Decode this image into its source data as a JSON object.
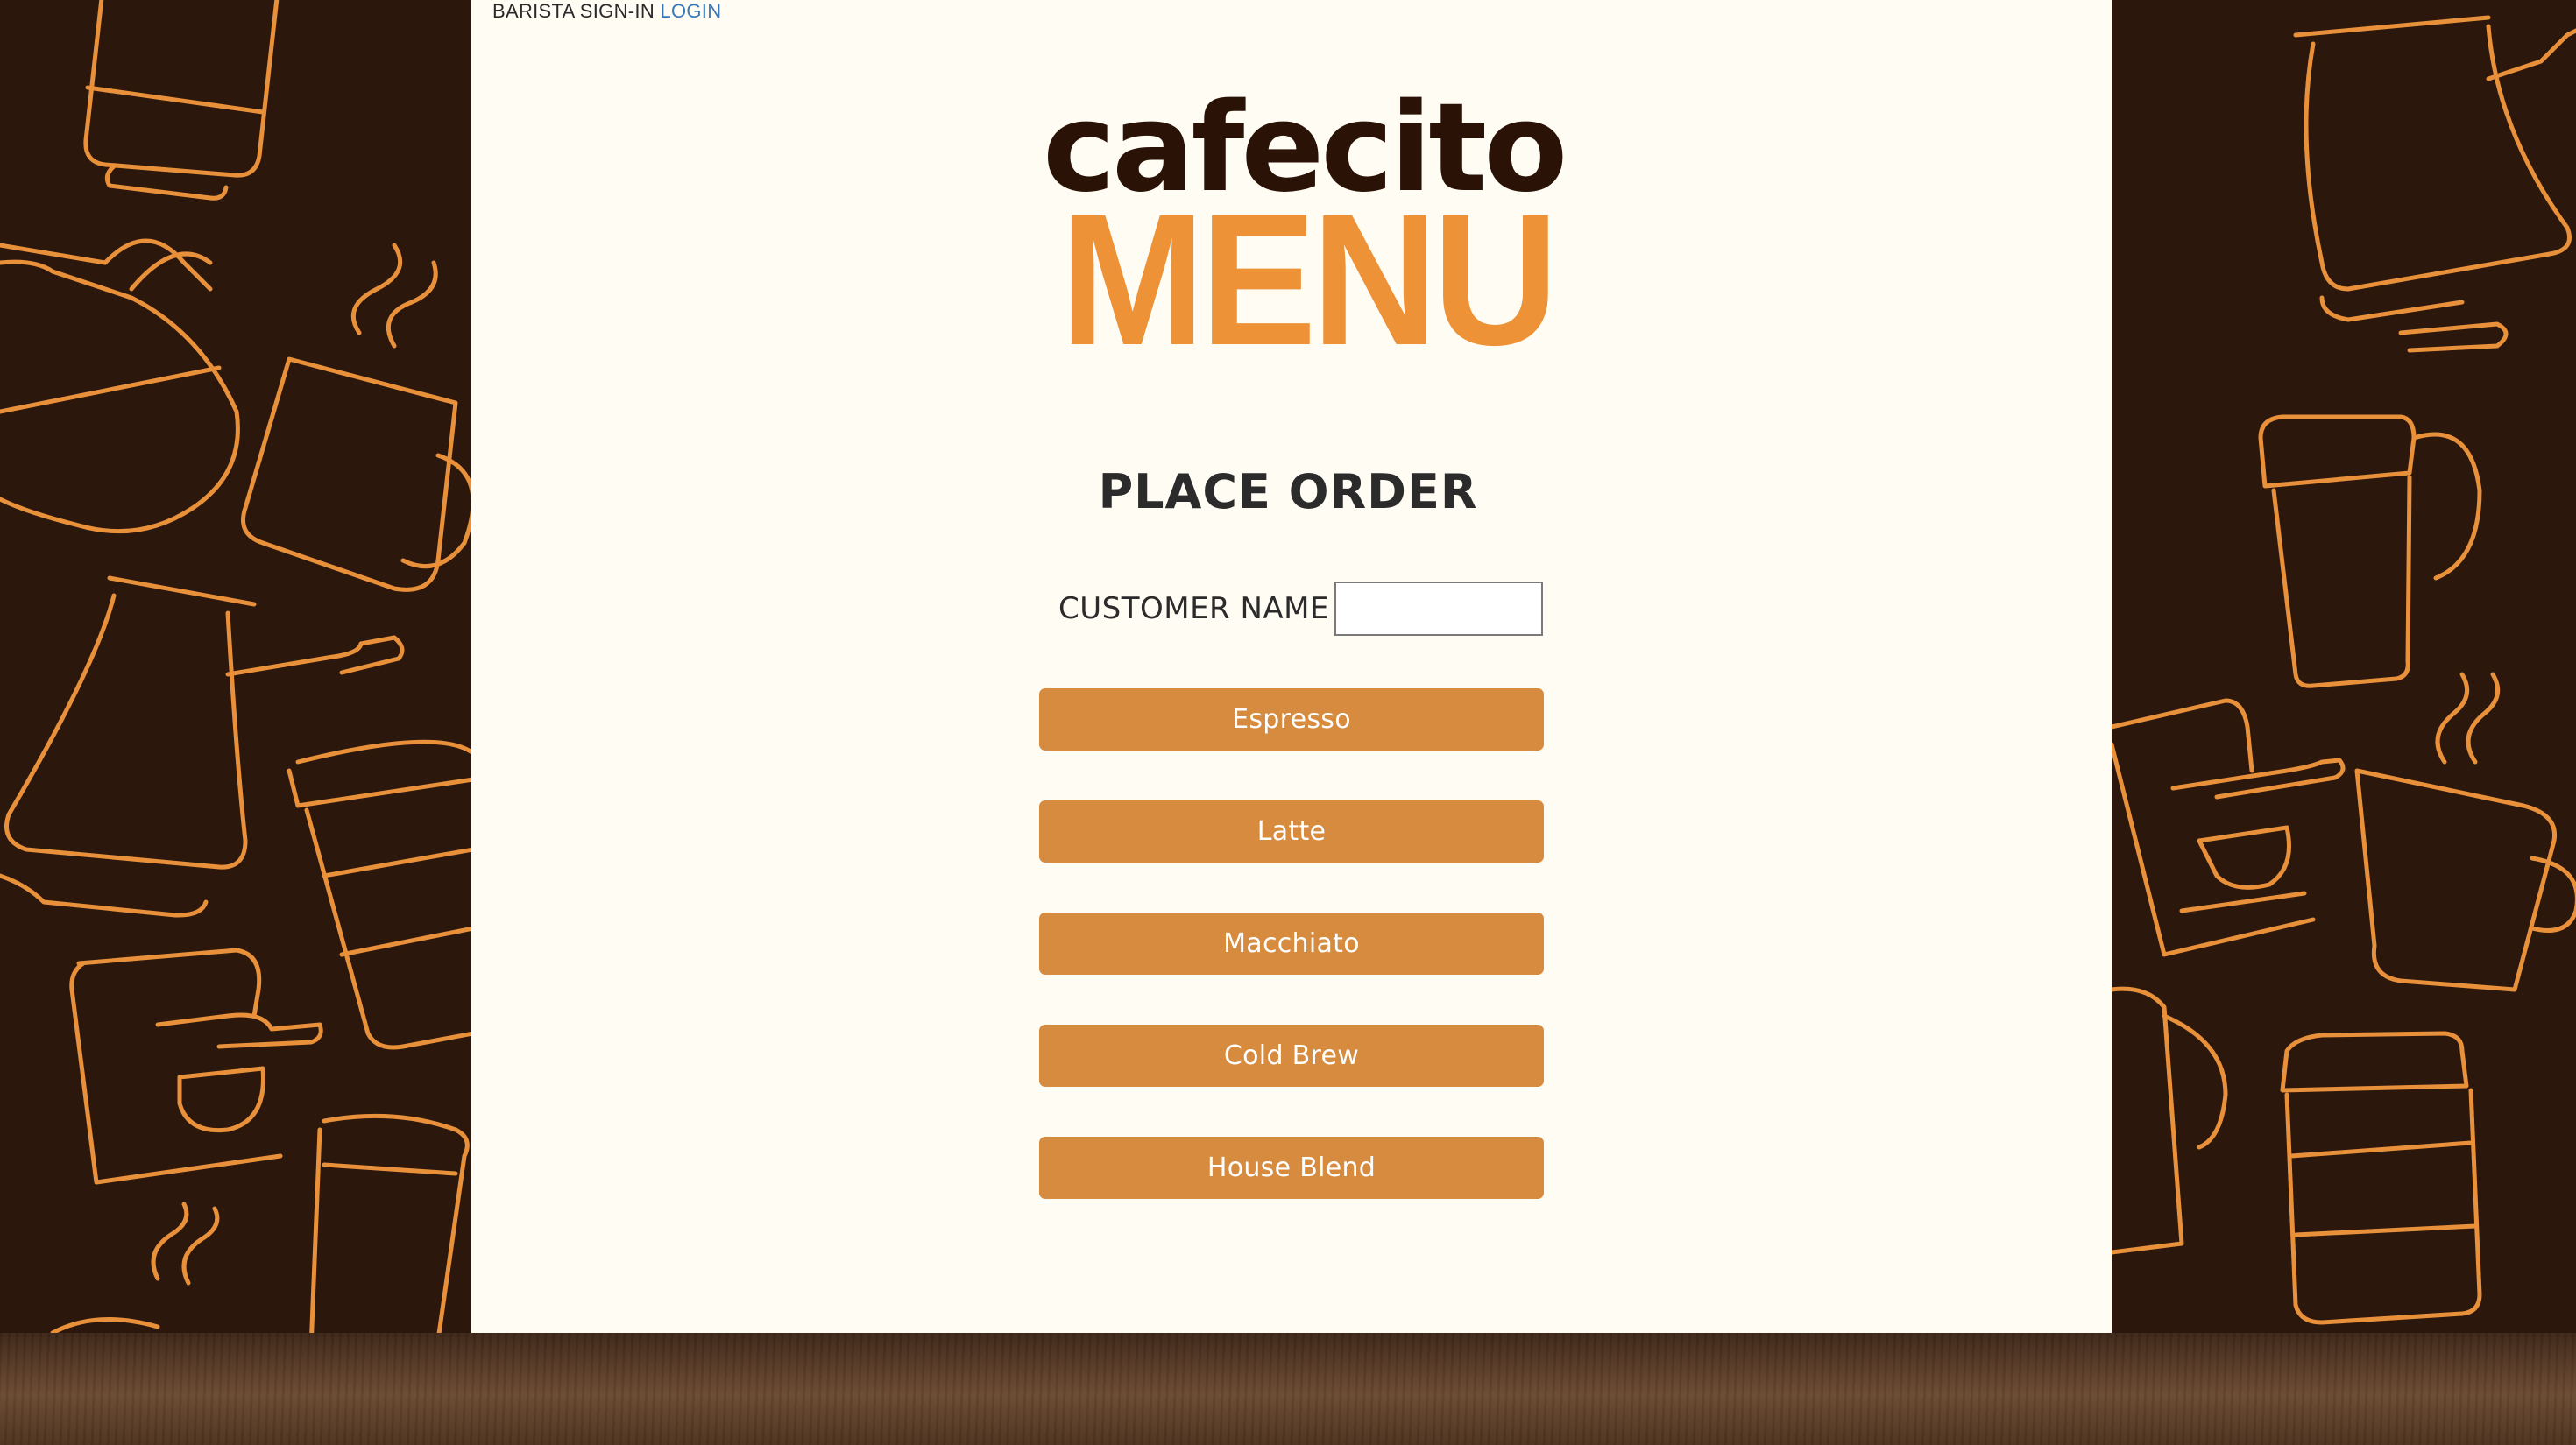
{
  "header": {
    "signin_text": "BARISTA SIGN-IN",
    "login_link": "LOGIN"
  },
  "logo": {
    "top_text": "cafecito",
    "bottom_text": "MENU"
  },
  "order": {
    "title": "PLACE ORDER",
    "customer_label": "CUSTOMER NAME",
    "customer_value": ""
  },
  "menu_items": [
    {
      "label": "Espresso"
    },
    {
      "label": "Latte"
    },
    {
      "label": "Macchiato"
    },
    {
      "label": "Cold Brew"
    },
    {
      "label": "House Blend"
    }
  ],
  "colors": {
    "background_dark": "#2c170d",
    "panel": "#fffcf4",
    "accent_orange": "#d68b3e",
    "logo_orange": "#ee9238",
    "logo_brown": "#2a1207",
    "link_blue": "#3978b8",
    "doodle_stroke": "#e8903a"
  },
  "decorations": {
    "left_icons": [
      "coffee-tumbler-icon",
      "coffee-pot-icon",
      "coffee-mug-icon",
      "turkish-coffee-pot-icon",
      "travel-cup-icon",
      "espresso-machine-icon",
      "steam-icon"
    ],
    "right_icons": [
      "turkish-coffee-pot-icon",
      "travel-mug-icon",
      "espresso-machine-icon",
      "coffee-mug-icon",
      "steam-icon",
      "travel-cup-icon"
    ]
  }
}
